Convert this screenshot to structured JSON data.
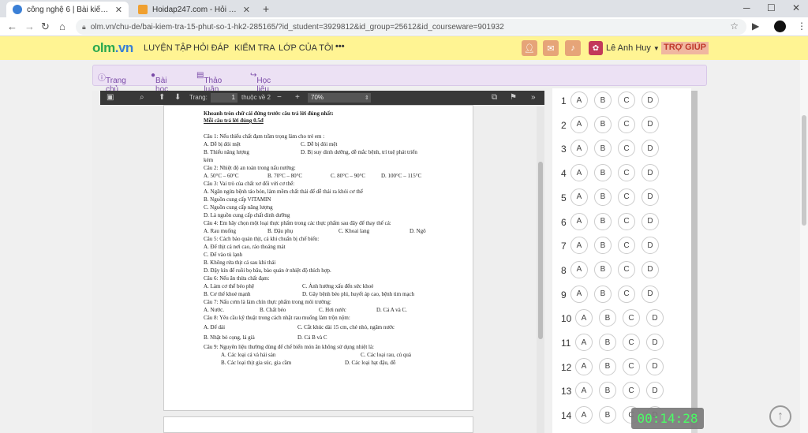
{
  "browser": {
    "tabs": [
      {
        "title": "công nghệ 6 | Bài kiểm tra 15 phút",
        "active": true
      },
      {
        "title": "Hoidap247.com - Hỏi đáp bài tập",
        "active": false
      }
    ],
    "url": "olm.vn/chu-de/bai-kiem-tra-15-phut-so-1-hk2-285165/?id_student=3929812&id_group=25612&id_courseware=901932"
  },
  "site": {
    "logo_main": "olm",
    "logo_tld": ".vn",
    "menu": [
      "LUYỆN TẬP",
      "HỎI ĐÁP",
      "KIỂM TRA",
      "LỚP CỦA TÔI",
      "•••"
    ],
    "user_name": "Lê Anh Huy",
    "help": "TRỢ GIÚP"
  },
  "subnav": [
    "Trang chủ",
    "Bài học",
    "Thảo luận",
    "Học liệu khác"
  ],
  "pdf_toolbar": {
    "page_label": "Trang:",
    "page_value": "1",
    "page_total": "thuộc về 2",
    "zoom": "70%"
  },
  "document": {
    "lines": [
      "Khoanh tròn chữ cái đứng trước câu trả lời đúng nhất:",
      "Mỗi câu trả lời đúng 0.5đ",
      "Câu 1: Nếu thiếu chất đạm trầm trọng làm cho trẻ em :",
      "A. Dễ bị đói mệt",
      "C. Dễ bị đói mệt",
      "B. Thiếu năng lượng",
      "D. Bị suy dinh dưỡng, dễ mắc bệnh, trí tuệ phát triển",
      "kém",
      "Câu 2: Nhiệt độ an toàn trong nấu nướng:",
      "A. 50°C – 60°C",
      "B. 70°C – 80°C",
      "C. 80°C – 90°C",
      "D. 100°C – 115°C",
      "Câu 3: Vai trò của chất xơ đối với cơ thể:",
      "A. Ngăn ngừa bệnh táo bón, làm mềm chất thải để dễ thải ra khỏi cơ thể",
      "B. Nguồn cung cấp VITAMIN",
      "C. Nguồn cung cấp năng lượng",
      "D. Là nguồn cung cấp chất dinh dưỡng",
      "Câu 4: Em hãy chọn một loại thực phẩm trong các thực phẩm sau đây để thay thế cá:",
      "A. Rau muống",
      "B. Đậu phụ",
      "C. Khoai lang",
      "D. Ngô",
      "Câu 5: Cách bảo quản thịt, cá khi chuẩn bị chế biến:",
      "A. Để thịt cá nơi cao, ráo thoáng mát",
      "C. Để vào tủ lạnh",
      "B. Không rửa thịt cá sau khi thái",
      "D. Đậy kín để ruồi bọ bâu, bảo quản ở nhiệt độ thích hợp.",
      "Câu 6: Nếu ăn thừa chất đạm:",
      "A. Làm cơ thể béo phệ",
      "C. Ảnh hưởng xấu đến sức khoẻ",
      "B. Cơ thể khoẻ mạnh",
      "D. Gây bệnh béo phì, huyết áp cao, bệnh tim mạch",
      "Câu 7: Nấu cơm là làm chín thực phẩm trong môi trường:",
      "A. Nước.",
      "B. Chất béo",
      "C. Hơi nước",
      "D. Cả A và C.",
      "Câu 8: Yêu cầu kỹ thuật trong cách nhặt rau muống làm trộn nộm:",
      "A. Để dài",
      "C. Cắt khúc dài 15 cm, chẻ nhỏ, ngâm nước",
      "B. Nhặt bỏ cọng, lá già",
      "D. Cả B và C",
      "Câu 9: Nguyên liệu thường dùng để chế biến món ăn không sử dụng nhiệt là:",
      "A. Các loại cá và hải sản",
      "C. Các loại rau, củ quả",
      "B. Các loại thịt gia súc, gia cầm",
      "D. Các loại hạt đậu, đỗ"
    ]
  },
  "answer_sheet": {
    "options": [
      "A",
      "B",
      "C",
      "D"
    ],
    "numbers": [
      "1",
      "2",
      "3",
      "4",
      "5",
      "6",
      "7",
      "8",
      "9",
      "10",
      "11",
      "12",
      "13",
      "14"
    ]
  },
  "timer": "00:14:28"
}
